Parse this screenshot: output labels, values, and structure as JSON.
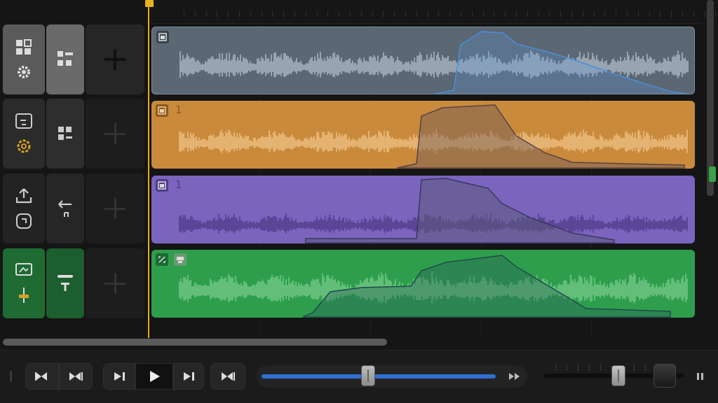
{
  "tracks": [
    {
      "name": "track-1",
      "color": "#5b6773",
      "region_number": "",
      "header_color": "#555555"
    },
    {
      "name": "track-2",
      "color": "#c98a3c",
      "region_number": "1",
      "header_color": "#2a2a2a"
    },
    {
      "name": "track-3",
      "color": "#7a64be",
      "region_number": "1",
      "header_color": "#2a2a2a"
    },
    {
      "name": "track-4",
      "color": "#2e9e4d",
      "region_number": "",
      "header_color": "#23733a"
    }
  ],
  "icons": {
    "header_track1": [
      "layout-grid-icon",
      "gear-icon",
      "module-grid-icon",
      "add-plus-icon"
    ],
    "header_track2": [
      "note-frame-icon",
      "settings-cog-icon",
      "module-grid-icon",
      "add-plus-icon"
    ],
    "header_track3": [
      "upload-icon",
      "loop-icon",
      "arrow-left-icon",
      "add-plus-icon"
    ],
    "header_track4": [
      "monitor-icon",
      "fader-icon",
      "text-t-icon",
      "add-plus-icon"
    ]
  },
  "transport": {
    "buttons": [
      "rewind-icon",
      "skip-back-icon",
      "step-forward-icon",
      "play-icon",
      "step-end-icon",
      "skip-forward-icon"
    ],
    "position_fraction": 0.42,
    "volume_fraction": 0.53
  },
  "colors": {
    "playhead": "#e2ad1a",
    "accent_blue": "#2e6fd4",
    "level_green": "#3aa14a"
  }
}
